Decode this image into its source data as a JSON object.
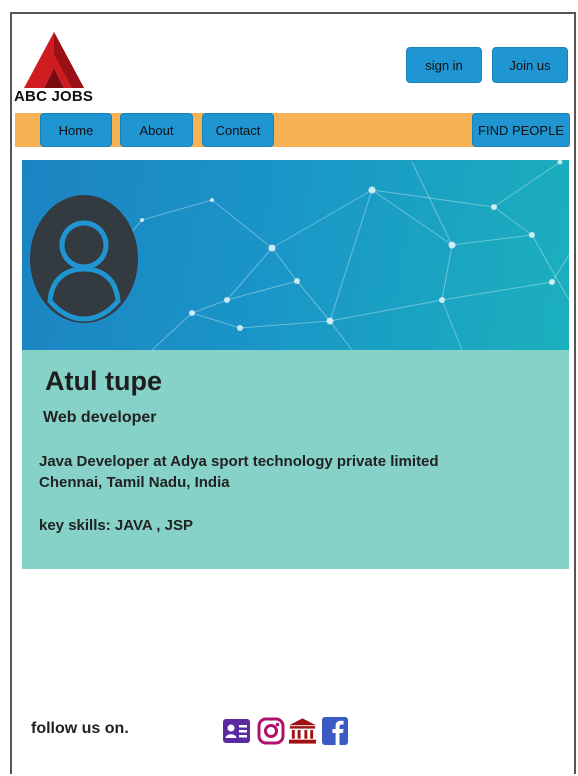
{
  "brand": {
    "logo_text": "ABC JOBS"
  },
  "header": {
    "sign_in": "sign in",
    "join_us": "Join us"
  },
  "nav": {
    "home": "Home",
    "about": "About",
    "contact": "Contact",
    "find_people": "FIND PEOPLE"
  },
  "profile": {
    "name": "Atul tupe",
    "title": "Web developer",
    "position": "Java Developer at Adya sport technology private limited",
    "location": "Chennai, Tamil Nadu, India",
    "skills": "key skills:  JAVA , JSP"
  },
  "footer": {
    "follow_label": "follow us on.",
    "social_icons": [
      "contact-card-icon",
      "instagram-icon",
      "bank-icon",
      "facebook-icon"
    ]
  },
  "colors": {
    "nav_bar": "#f7b256",
    "button": "#1f95d2",
    "card": "#86d2c8",
    "banner_start": "#1c83c2",
    "banner_end": "#1bb0bd",
    "logo_red": "#c8181e"
  }
}
